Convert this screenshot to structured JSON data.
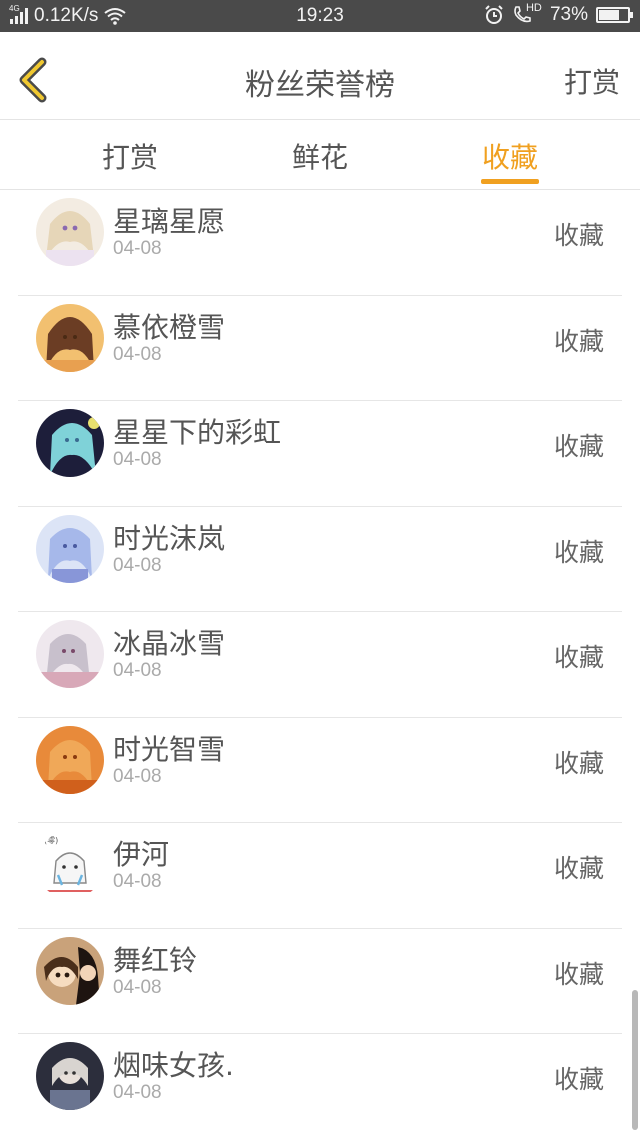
{
  "status_bar": {
    "network": "4G",
    "speed": "0.12K/s",
    "time": "19:23",
    "hd": "HD",
    "battery": "73%",
    "battery_level": 0.73
  },
  "header": {
    "title": "粉丝荣誉榜",
    "action": "打赏",
    "back_icon": "chevron-left-icon",
    "accent_color": "#f0a020"
  },
  "tabs": [
    {
      "label": "打赏",
      "active": false
    },
    {
      "label": "鲜花",
      "active": false
    },
    {
      "label": "收藏",
      "active": true
    }
  ],
  "list": [
    {
      "name": "星璃星愿",
      "date": "04-08",
      "action": "收藏"
    },
    {
      "name": "慕依橙雪",
      "date": "04-08",
      "action": "收藏"
    },
    {
      "name": "星星下的彩虹",
      "date": "04-08",
      "action": "收藏"
    },
    {
      "name": "时光沫岚",
      "date": "04-08",
      "action": "收藏"
    },
    {
      "name": "冰晶冰雪",
      "date": "04-08",
      "action": "收藏"
    },
    {
      "name": "时光智雪",
      "date": "04-08",
      "action": "收藏"
    },
    {
      "name": "伊河",
      "date": "04-08",
      "action": "收藏"
    },
    {
      "name": "舞红铃",
      "date": "04-08",
      "action": "收藏"
    },
    {
      "name": "烟味女孩.",
      "date": "04-08",
      "action": "收藏"
    }
  ]
}
